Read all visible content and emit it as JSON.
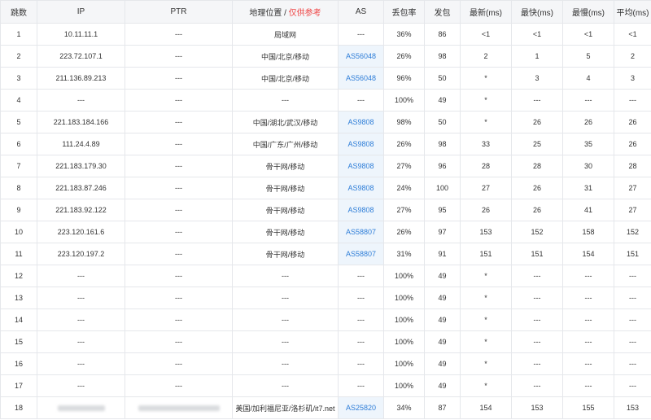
{
  "header": {
    "hop": "跳数",
    "ip": "IP",
    "ptr": "PTR",
    "location": "地理位置 /",
    "location_note": "仅供参考",
    "as": "AS",
    "loss": "丢包率",
    "sent": "发包",
    "last": "最新(ms)",
    "best": "最快(ms)",
    "worst": "最慢(ms)",
    "avg": "平均(ms)"
  },
  "rows": [
    {
      "hop": "1",
      "ip": "10.11.11.1",
      "ptr": "---",
      "location": "局域网",
      "as": "---",
      "loss": "36%",
      "sent": "86",
      "last": "<1",
      "best": "<1",
      "worst": "<1",
      "avg": "<1"
    },
    {
      "hop": "2",
      "ip": "223.72.107.1",
      "ptr": "---",
      "location": "中国/北京/移动",
      "as": "AS56048",
      "loss": "26%",
      "sent": "98",
      "last": "2",
      "best": "1",
      "worst": "5",
      "avg": "2"
    },
    {
      "hop": "3",
      "ip": "211.136.89.213",
      "ptr": "---",
      "location": "中国/北京/移动",
      "as": "AS56048",
      "loss": "96%",
      "sent": "50",
      "last": "*",
      "best": "3",
      "worst": "4",
      "avg": "3"
    },
    {
      "hop": "4",
      "ip": "---",
      "ptr": "---",
      "location": "---",
      "as": "---",
      "loss": "100%",
      "sent": "49",
      "last": "*",
      "best": "---",
      "worst": "---",
      "avg": "---"
    },
    {
      "hop": "5",
      "ip": "221.183.184.166",
      "ptr": "---",
      "location": "中国/湖北/武汉/移动",
      "as": "AS9808",
      "loss": "98%",
      "sent": "50",
      "last": "*",
      "best": "26",
      "worst": "26",
      "avg": "26"
    },
    {
      "hop": "6",
      "ip": "111.24.4.89",
      "ptr": "---",
      "location": "中国/广东/广州/移动",
      "as": "AS9808",
      "loss": "26%",
      "sent": "98",
      "last": "33",
      "best": "25",
      "worst": "35",
      "avg": "26"
    },
    {
      "hop": "7",
      "ip": "221.183.179.30",
      "ptr": "---",
      "location": "骨干网/移动",
      "as": "AS9808",
      "loss": "27%",
      "sent": "96",
      "last": "28",
      "best": "28",
      "worst": "30",
      "avg": "28"
    },
    {
      "hop": "8",
      "ip": "221.183.87.246",
      "ptr": "---",
      "location": "骨干网/移动",
      "as": "AS9808",
      "loss": "24%",
      "sent": "100",
      "last": "27",
      "best": "26",
      "worst": "31",
      "avg": "27"
    },
    {
      "hop": "9",
      "ip": "221.183.92.122",
      "ptr": "---",
      "location": "骨干网/移动",
      "as": "AS9808",
      "loss": "27%",
      "sent": "95",
      "last": "26",
      "best": "26",
      "worst": "41",
      "avg": "27"
    },
    {
      "hop": "10",
      "ip": "223.120.161.6",
      "ptr": "---",
      "location": "骨干网/移动",
      "as": "AS58807",
      "loss": "26%",
      "sent": "97",
      "last": "153",
      "best": "152",
      "worst": "158",
      "avg": "152"
    },
    {
      "hop": "11",
      "ip": "223.120.197.2",
      "ptr": "---",
      "location": "骨干网/移动",
      "as": "AS58807",
      "loss": "31%",
      "sent": "91",
      "last": "151",
      "best": "151",
      "worst": "154",
      "avg": "151"
    },
    {
      "hop": "12",
      "ip": "---",
      "ptr": "---",
      "location": "---",
      "as": "---",
      "loss": "100%",
      "sent": "49",
      "last": "*",
      "best": "---",
      "worst": "---",
      "avg": "---"
    },
    {
      "hop": "13",
      "ip": "---",
      "ptr": "---",
      "location": "---",
      "as": "---",
      "loss": "100%",
      "sent": "49",
      "last": "*",
      "best": "---",
      "worst": "---",
      "avg": "---"
    },
    {
      "hop": "14",
      "ip": "---",
      "ptr": "---",
      "location": "---",
      "as": "---",
      "loss": "100%",
      "sent": "49",
      "last": "*",
      "best": "---",
      "worst": "---",
      "avg": "---"
    },
    {
      "hop": "15",
      "ip": "---",
      "ptr": "---",
      "location": "---",
      "as": "---",
      "loss": "100%",
      "sent": "49",
      "last": "*",
      "best": "---",
      "worst": "---",
      "avg": "---"
    },
    {
      "hop": "16",
      "ip": "---",
      "ptr": "---",
      "location": "---",
      "as": "---",
      "loss": "100%",
      "sent": "49",
      "last": "*",
      "best": "---",
      "worst": "---",
      "avg": "---"
    },
    {
      "hop": "17",
      "ip": "---",
      "ptr": "---",
      "location": "---",
      "as": "---",
      "loss": "100%",
      "sent": "49",
      "last": "*",
      "best": "---",
      "worst": "---",
      "avg": "---"
    },
    {
      "hop": "18",
      "ip": "",
      "ptr": "",
      "location": "美国/加利福尼亚/洛杉矶/it7.net",
      "as": "AS25820",
      "loss": "34%",
      "sent": "87",
      "last": "154",
      "best": "153",
      "worst": "155",
      "avg": "153",
      "redacted": true
    }
  ],
  "colors": {
    "as_link": "#2f7ed8",
    "warning": "#ef4444",
    "header_bg": "#f5f6f8",
    "as_cell_bg": "#eef5fc",
    "border": "#e5e7eb"
  }
}
